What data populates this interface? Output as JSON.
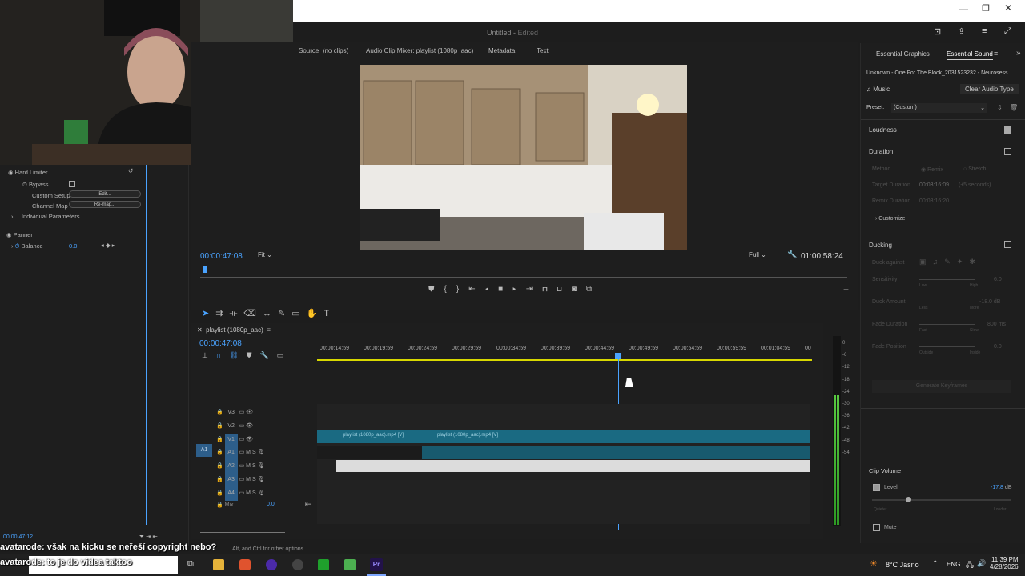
{
  "doc": {
    "title": "Untitled",
    "status": "Edited"
  },
  "left_panel": {
    "hard_limiter": "Hard Limiter",
    "bypass": "Bypass",
    "custom_setup": "Custom Setup",
    "custom_setup_btn": "Edit...",
    "channel_map": "Channel Map",
    "channel_map_btn": "Re-map...",
    "individual_params": "Individual Parameters",
    "panner": "Panner",
    "balance": "Balance",
    "balance_val": "0.0",
    "bottom_time": "00:00:47:12"
  },
  "monitor": {
    "tabs": [
      "Source: (no clips)",
      "Audio Clip Mixer: playlist (1080p_aac)",
      "Metadata",
      "Text"
    ],
    "timecode": "00:00:47:08",
    "fit": "Fit",
    "quality": "Full",
    "duration": "01:00:58:24"
  },
  "timeline": {
    "seq_name": "playlist (1080p_aac)",
    "timecode": "00:00:47:08",
    "ruler": [
      "00:00:14:59",
      "00:00:19:59",
      "00:00:24:59",
      "00:00:29:59",
      "00:00:34:59",
      "00:00:39:59",
      "00:00:44:59",
      "00:00:49:59",
      "00:00:54:59",
      "00:00:59:59",
      "00:01:04:59",
      "00"
    ],
    "tracks": [
      {
        "label": "V3"
      },
      {
        "label": "V2"
      },
      {
        "label": "V1"
      },
      {
        "label": "A1"
      },
      {
        "label": "A2"
      },
      {
        "label": "A3"
      },
      {
        "label": "A4"
      }
    ],
    "src_patch": "A1",
    "mix": "Mix",
    "mix_val": "0.0",
    "clip1": "playlist (1080p_aac).mp4 [V]",
    "clip2": "playlist (1080p_aac).mp4 [V]",
    "meter_ticks": [
      "0",
      "-6",
      "-12",
      "-18",
      "-24",
      "-30",
      "-36",
      "-42",
      "-48",
      "-54"
    ]
  },
  "essential": {
    "tab1": "Essential Graphics",
    "tab2": "Essential Sound",
    "clip_name": "Unknown - One For The Block_2031523232 - Neurosess...",
    "type": "Music",
    "clear_btn": "Clear Audio Type",
    "preset_label": "Preset:",
    "preset_val": "(Custom)",
    "loudness": "Loudness",
    "duration": "Duration",
    "method": "Method",
    "remix": "Remix",
    "stretch": "Stretch",
    "target_duration": "Target Duration",
    "target_val": "00:03:16:09",
    "target_note": "(±5 seconds)",
    "remix_duration": "Remix Duration",
    "remix_val": "00:03:16:20",
    "customize": "Customize",
    "ducking": "Ducking",
    "duck_against": "Duck against",
    "sensitivity": "Sensitivity",
    "sens_val": "6.0",
    "duck_amount": "Duck Amount",
    "duck_amount_val": "-18.0 dB",
    "fade_duration": "Fade Duration",
    "fade_dur_val": "800 ms",
    "fade_position": "Fade Position",
    "fade_pos_val": "0.0",
    "generate": "Generate Keyframes",
    "clip_volume": "Clip Volume",
    "level": "Level",
    "level_val": "-17.8",
    "db": "dB",
    "mute": "Mute",
    "less": "Less",
    "more": "More",
    "high": "High",
    "low": "Low",
    "fast": "Fast",
    "slow": "Slow",
    "outside": "Outside",
    "inside": "Inside",
    "quieter": "Quieter",
    "louder": "Louder"
  },
  "status_hint": "Alt, and Ctrl for other options.",
  "chat": {
    "user1": "avatarode:",
    "msg1": "však na kicku se neřeší copyright nebo?",
    "user2": "avatarode:",
    "msg2": "to je do videa taktoo"
  },
  "taskbar": {
    "weather": "8°C  Jasno",
    "lang": "ENG",
    "time": "11:39 PM",
    "date": "4/28/2026"
  }
}
